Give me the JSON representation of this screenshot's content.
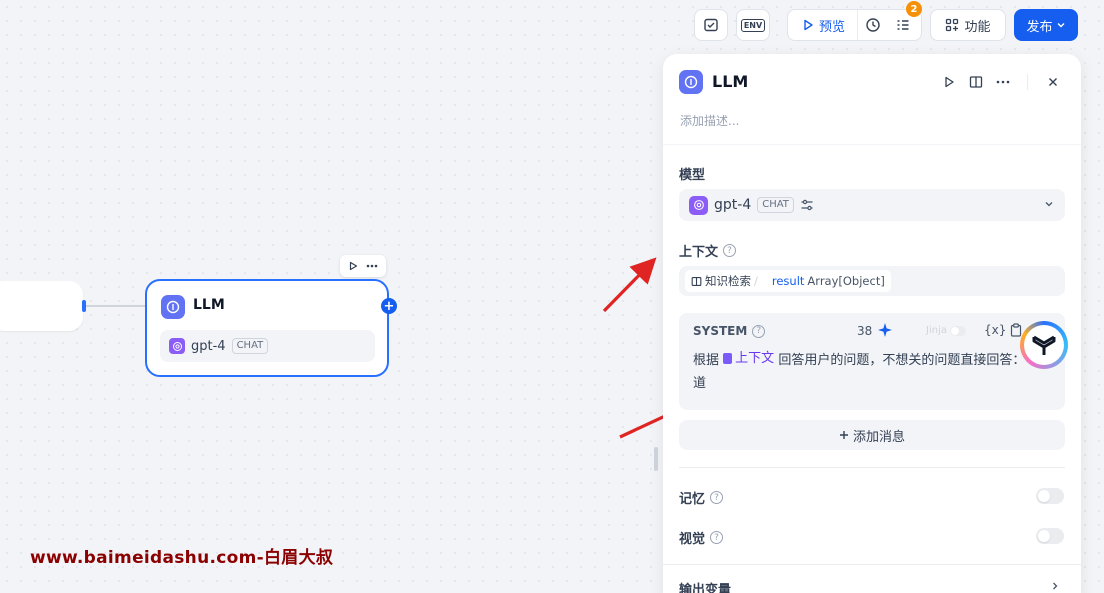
{
  "toolbar": {
    "checklist_icon": "checklist-icon",
    "env_label": "ENV",
    "preview_label": "预览",
    "history_icon": "history-icon",
    "list_icon": "list-icon",
    "badge_count": "2",
    "features_label": "功能",
    "publish_label": "发布"
  },
  "canvas": {
    "node": {
      "title": "LLM",
      "model_name": "gpt-4",
      "model_tag": "CHAT",
      "plus": "+"
    },
    "watermark": "www.baimeidashu.com-白眉大叔"
  },
  "panel": {
    "title": "LLM",
    "description_placeholder": "添加描述...",
    "model_section": {
      "label": "模型",
      "model_name": "gpt-4",
      "model_tag": "CHAT"
    },
    "context_section": {
      "label": "上下文",
      "help": "?",
      "source_label": "知识检索",
      "separator": "/",
      "variable": "result",
      "variable_type": "Array[Object]"
    },
    "system_prompt": {
      "label": "SYSTEM",
      "help": "?",
      "char_count": "38",
      "jinja_label": "Jinja",
      "variable_btn": "{x}",
      "text_prefix": "根据",
      "context_token": "上下文",
      "text_suffix": " 回答用户的问题，不想关的问题直接回答：不知道"
    },
    "add_message_label": "添加消息",
    "memory": {
      "label": "记忆",
      "help": "?",
      "enabled": false
    },
    "vision": {
      "label": "视觉",
      "help": "?",
      "enabled": false
    },
    "output_vars_label": "输出变量"
  },
  "colors": {
    "accent": "#155eef",
    "node_icon": "#6172f3",
    "gpt_icon": "#8b5cf6",
    "badge": "#f79009",
    "watermark": "#8b0000",
    "arrow": "#e02424"
  }
}
